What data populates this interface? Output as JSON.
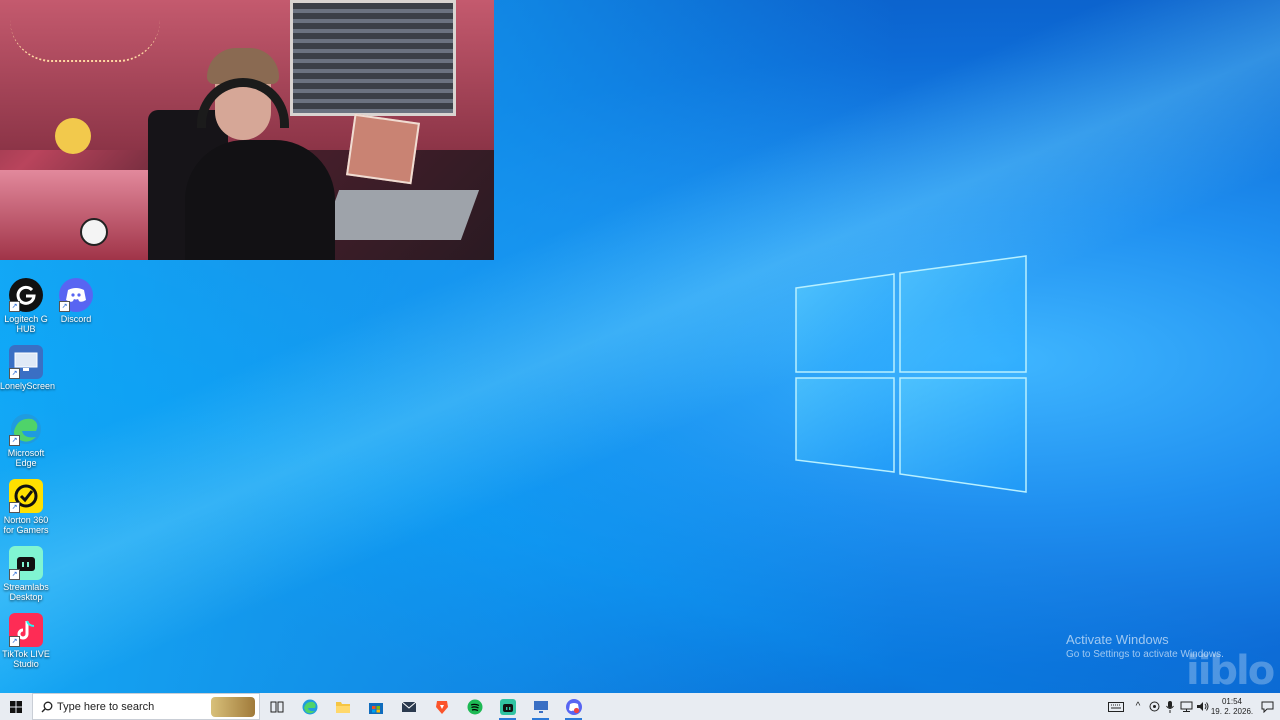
{
  "desktop": {
    "icons": [
      {
        "label": "Logitech G HUB",
        "icon": "logitech-icon",
        "bg": "#111111"
      },
      {
        "label": "Discord",
        "icon": "discord-icon",
        "bg": "#5865f2"
      },
      {
        "label": "LonelyScreen",
        "icon": "monitor-icon",
        "bg": "#4a78c9"
      },
      {
        "label": "Microsoft Edge",
        "icon": "edge-icon",
        "bg": "#1f9be0"
      },
      {
        "label": "Norton 360 for Gamers",
        "icon": "norton-icon",
        "bg": "#ffe000"
      },
      {
        "label": "Streamlabs Desktop",
        "icon": "streamlabs-icon",
        "bg": "#80f5d2"
      },
      {
        "label": "TikTok LIVE Studio",
        "icon": "tiktok-icon",
        "bg": "#fe2c55"
      }
    ]
  },
  "activation": {
    "title": "Activate Windows",
    "subtitle": "Go to Settings to activate Windows."
  },
  "watermark": "iiblo",
  "taskbar": {
    "search_placeholder": "Type here to search",
    "apps": [
      "task-view-icon",
      "edge-icon",
      "file-explorer-icon",
      "store-icon",
      "mail-icon",
      "brave-icon",
      "spotify-icon",
      "streamlabs-icon",
      "remote-desktop-icon",
      "discord-icon"
    ],
    "clock": {
      "time": "01:54",
      "date": "19. 2. 2026."
    }
  }
}
